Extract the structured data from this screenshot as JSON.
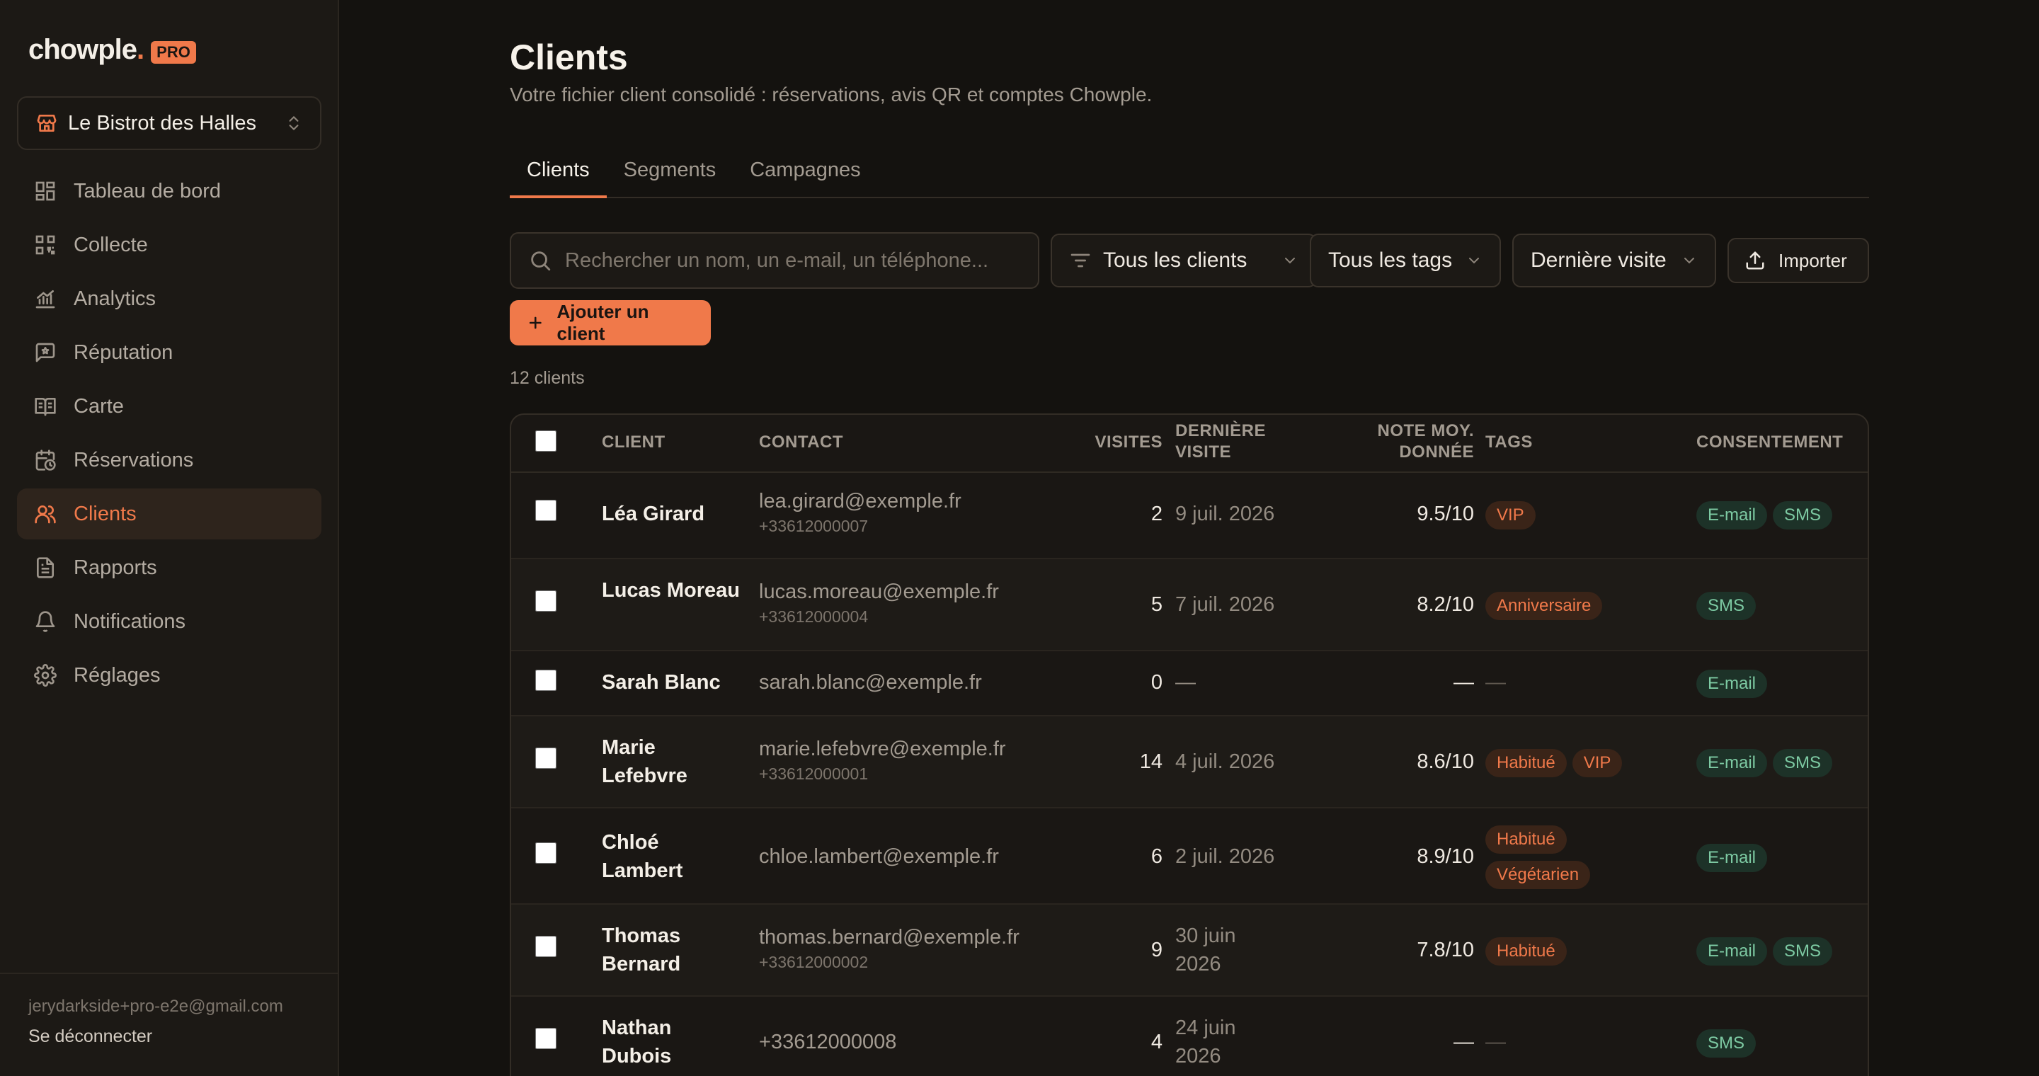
{
  "brand": {
    "name": "chowple",
    "dot": ".",
    "badge": "PRO"
  },
  "venue": {
    "name": "Le Bistrot des Halles"
  },
  "nav": [
    {
      "label": "Tableau de bord",
      "icon": "dashboard-icon"
    },
    {
      "label": "Collecte",
      "icon": "qr-code-icon"
    },
    {
      "label": "Analytics",
      "icon": "analytics-icon"
    },
    {
      "label": "Réputation",
      "icon": "message-star-icon"
    },
    {
      "label": "Carte",
      "icon": "book-icon"
    },
    {
      "label": "Réservations",
      "icon": "calendar-clock-icon"
    },
    {
      "label": "Clients",
      "icon": "users-icon",
      "active": true
    },
    {
      "label": "Rapports",
      "icon": "document-icon"
    },
    {
      "label": "Notifications",
      "icon": "bell-icon"
    },
    {
      "label": "Réglages",
      "icon": "gear-icon"
    }
  ],
  "account": {
    "email": "jerydarkside+pro-e2e@gmail.com",
    "logout": "Se déconnecter"
  },
  "page": {
    "title": "Clients",
    "subtitle": "Votre fichier client consolidé : réservations, avis QR et comptes Chowple."
  },
  "tabs": [
    "Clients",
    "Segments",
    "Campagnes"
  ],
  "toolbar": {
    "search_placeholder": "Rechercher un nom, un e-mail, un téléphone...",
    "filter_clients": "Tous les clients",
    "filter_tags": "Tous les tags",
    "filter_visit": "Dernière visite",
    "import": "Importer",
    "add_client": "Ajouter un client"
  },
  "count": "12 clients",
  "table": {
    "headers": {
      "client": "CLIENT",
      "contact": "CONTACT",
      "visits": "VISITES",
      "last_visit_1": "DERNIÈRE",
      "last_visit_2": "VISITE",
      "note_1": "NOTE MOY.",
      "note_2": "DONNÉE",
      "tags": "TAGS",
      "consent": "CONSENTEMENT"
    },
    "rows": [
      {
        "name": "Léa Girard",
        "email": "lea.girard@exemple.fr",
        "phone": "+33612000007",
        "visits": "2",
        "last": "9 juil. 2026",
        "note": "9.5/10",
        "tags": [
          "VIP"
        ],
        "consent": [
          "E-mail",
          "SMS"
        ]
      },
      {
        "name": "Lucas Moreau",
        "email": "lucas.moreau@exemple.fr",
        "phone": "+33612000004",
        "visits": "5",
        "last": "7 juil. 2026",
        "note": "8.2/10",
        "tags": [
          "Anniversaire"
        ],
        "consent": [
          "SMS"
        ]
      },
      {
        "name": "Sarah Blanc",
        "email": "sarah.blanc@exemple.fr",
        "phone": "",
        "visits": "0",
        "last": "—",
        "note": "—",
        "tags": [],
        "consent": [
          "E-mail"
        ]
      },
      {
        "name": "Marie Lefebvre",
        "email": "marie.lefebvre@exemple.fr",
        "phone": "+33612000001",
        "visits": "14",
        "last": "4 juil. 2026",
        "note": "8.6/10",
        "tags": [
          "Habitué",
          "VIP"
        ],
        "consent": [
          "E-mail",
          "SMS"
        ]
      },
      {
        "name": "Chloé Lambert",
        "email": "chloe.lambert@exemple.fr",
        "phone": "",
        "visits": "6",
        "last": "2 juil. 2026",
        "note": "8.9/10",
        "tags": [
          "Habitué",
          "Végétarien"
        ],
        "consent": [
          "E-mail"
        ]
      },
      {
        "name": "Thomas Bernard",
        "email": "thomas.bernard@exemple.fr",
        "phone": "+33612000002",
        "visits": "9",
        "last": "30 juin 2026",
        "note": "7.8/10",
        "tags": [
          "Habitué"
        ],
        "consent": [
          "E-mail",
          "SMS"
        ]
      },
      {
        "name": "Nathan Dubois",
        "email": "+33612000008",
        "phone": "",
        "visits": "4",
        "last": "24 juin 2026",
        "note": "—",
        "tags": [],
        "consent": [
          "SMS"
        ]
      }
    ]
  },
  "colors": {
    "accent": "#f0794a",
    "consent_bg": "#1d3228",
    "consent_text": "#7dcaa3",
    "tag_bg": "#3a2418"
  }
}
